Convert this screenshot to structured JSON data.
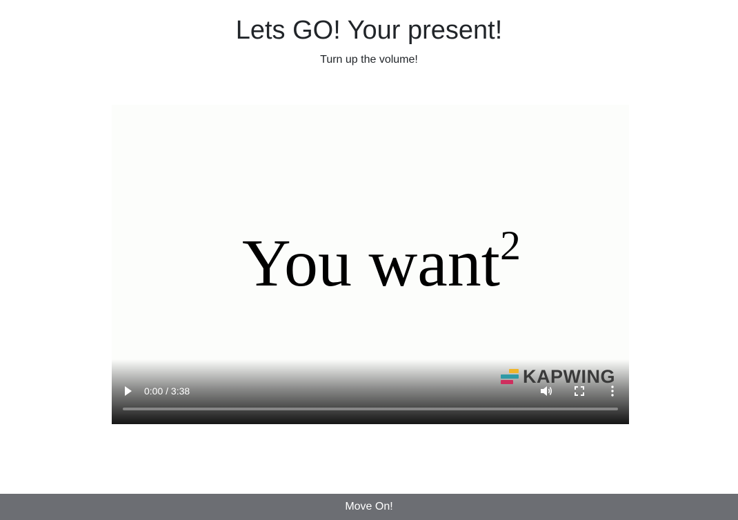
{
  "header": {
    "title": "Lets GO! Your present!",
    "subtitle": "Turn up the volume!"
  },
  "video": {
    "caption_main": "You want",
    "caption_sup": "2",
    "watermark": "KAPWING",
    "watermark_colors": [
      "#f0b529",
      "#2e9aa6",
      "#cf2e5e"
    ],
    "time_display": "0:00 / 3:38",
    "progress": 0,
    "icons": {
      "play": "play-icon",
      "volume": "volume-icon",
      "fullscreen": "fullscreen-icon",
      "more": "more-options-icon"
    }
  },
  "footer": {
    "button_label": "Move On!",
    "background": "#6c6e73"
  }
}
